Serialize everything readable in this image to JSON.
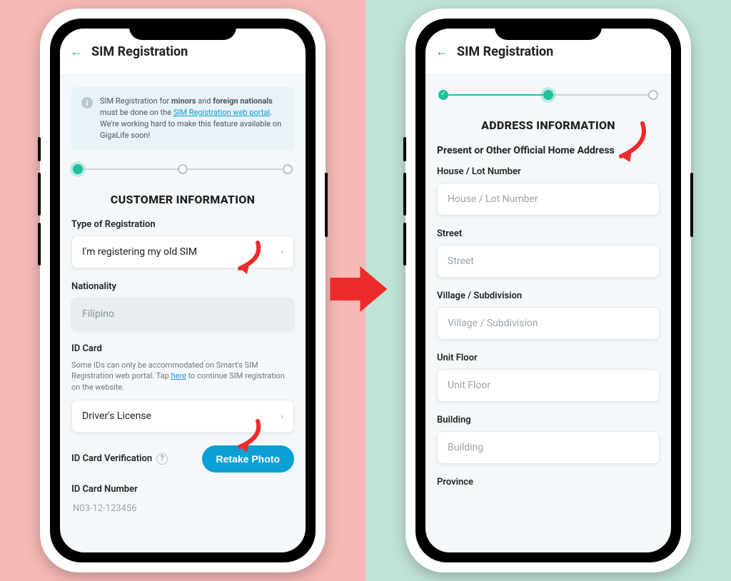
{
  "left": {
    "header": {
      "title": "SIM Registration"
    },
    "banner": {
      "text_before": "SIM Registration for ",
      "bold1": "minors",
      "text_mid": " and ",
      "bold2": "foreign nationals",
      "text_after1": " must be done on the ",
      "link": "SIM Registration web portal",
      "text_after2": ". We're working hard to make this feature available on GigaLife soon!"
    },
    "section_title": "CUSTOMER INFORMATION",
    "type_label": "Type of Registration",
    "type_value": "I'm registering my old SIM",
    "nationality_label": "Nationality",
    "nationality_value": "Filipino",
    "id_card_label": "ID Card",
    "id_card_hint_before": "Some IDs can only be accommodated on Smart's SIM Registration web portal. Tap ",
    "id_card_hint_link": "here",
    "id_card_hint_after": " to continue SIM registration on the website.",
    "id_card_value": "Driver's License",
    "id_verify_label": "ID Card Verification",
    "retake_btn": "Retake Photo",
    "id_number_label": "ID Card Number",
    "id_number_value": "N03-12-123456"
  },
  "right": {
    "header": {
      "title": "SIM Registration"
    },
    "section_title": "ADDRESS INFORMATION",
    "sub_heading": "Present or Other Official Home Address",
    "fields": {
      "house": {
        "label": "House / Lot Number",
        "placeholder": "House / Lot Number"
      },
      "street": {
        "label": "Street",
        "placeholder": "Street"
      },
      "village": {
        "label": "Village / Subdivision",
        "placeholder": "Village / Subdivision"
      },
      "unit": {
        "label": "Unit Floor",
        "placeholder": "Unit Floor"
      },
      "building": {
        "label": "Building",
        "placeholder": "Building"
      },
      "province": {
        "label": "Province"
      }
    }
  },
  "colors": {
    "accent": "#0aa0d6",
    "red": "#ee2b2b",
    "green": "#1fc19a"
  }
}
